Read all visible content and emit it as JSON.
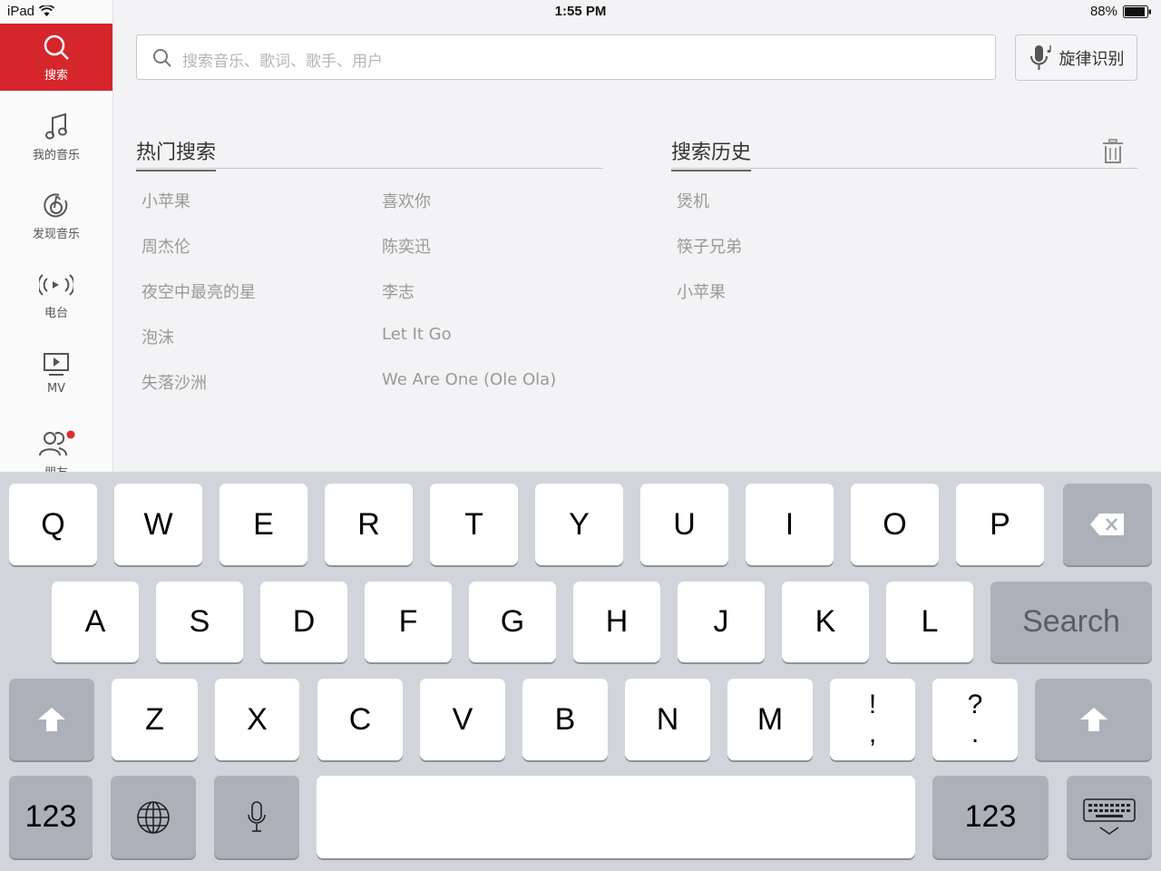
{
  "status_bar": {
    "device": "iPad",
    "time": "1:55 PM",
    "battery": "88%"
  },
  "sidebar": [
    {
      "label": "搜索",
      "icon": "search-icon"
    },
    {
      "label": "我的音乐",
      "icon": "music-note-icon"
    },
    {
      "label": "发现音乐",
      "icon": "netease-logo-icon"
    },
    {
      "label": "电台",
      "icon": "radio-icon"
    },
    {
      "label": "MV",
      "icon": "video-icon"
    },
    {
      "label": "朋友",
      "icon": "friends-icon"
    }
  ],
  "search": {
    "placeholder": "搜索音乐、歌词、歌手、用户",
    "humming_label": "旋律识别"
  },
  "hot_search": {
    "title": "热门搜索",
    "items": [
      "小苹果",
      "喜欢你",
      "周杰伦",
      "陈奕迅",
      "夜空中最亮的星",
      "李志",
      "泡沫",
      "Let It Go",
      "失落沙洲",
      "We Are One (Ole Ola)"
    ]
  },
  "history": {
    "title": "搜索历史",
    "items": [
      "煲机",
      "筷子兄弟",
      "小苹果"
    ]
  },
  "keyboard": {
    "row1": [
      "Q",
      "W",
      "E",
      "R",
      "T",
      "Y",
      "U",
      "I",
      "O",
      "P"
    ],
    "row2": [
      "A",
      "S",
      "D",
      "F",
      "G",
      "H",
      "J",
      "K",
      "L"
    ],
    "row3": [
      "Z",
      "X",
      "C",
      "V",
      "B",
      "N",
      "M"
    ],
    "sym1": [
      "!",
      ","
    ],
    "sym2": [
      "?",
      "."
    ],
    "search_label": "Search",
    "numbers_label": "123"
  },
  "colors": {
    "accent": "#d5262b",
    "keyboard_bg": "#d1d4da"
  }
}
